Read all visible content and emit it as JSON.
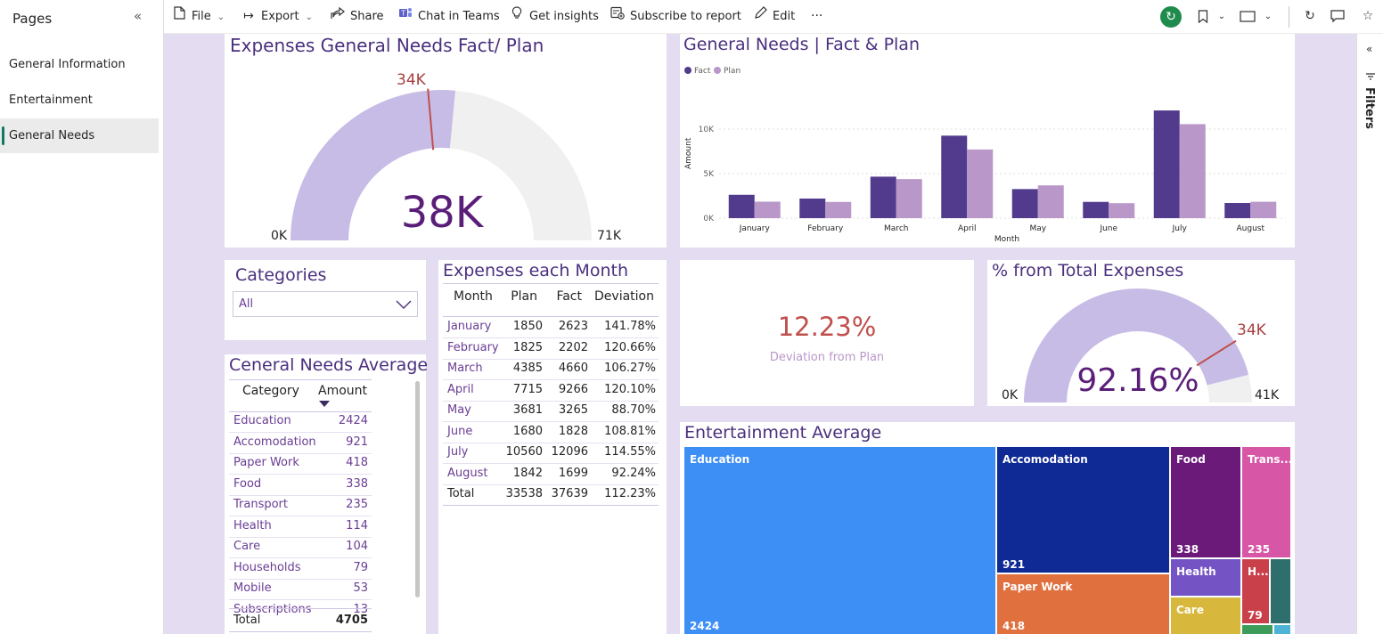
{
  "pages": {
    "title": "Pages",
    "collapse_icon": "«",
    "items": [
      {
        "label": "General Information"
      },
      {
        "label": "Entertainment"
      },
      {
        "label": "General Needs"
      }
    ]
  },
  "toolbar": {
    "file": "File",
    "export": "Export",
    "share": "Share",
    "teams": "Chat in Teams",
    "insights": "Get insights",
    "subscribe": "Subscribe to report",
    "edit": "Edit",
    "more": "···"
  },
  "filters": {
    "label": "Filters",
    "collapse_icon": "«"
  },
  "colors": {
    "canvas": "#e4dcf1",
    "fact": "#523b8d",
    "plan": "#b997c9",
    "gauge_fill": "#c7bce6",
    "gauge_empty": "#f0f0f0",
    "target": "#c0504d",
    "title": "#4a2f7e"
  },
  "gauge_main": {
    "title": "Expenses General Needs Fact/ Plan",
    "value_text": "38K",
    "min_text": "0K",
    "max_text": "71K",
    "target_text": "34K",
    "value": 37639,
    "min": 0,
    "max": 71000,
    "target": 33538
  },
  "bar_chart": {
    "title": "General Needs | Fact & Plan",
    "legend": [
      "Fact",
      "Plan"
    ],
    "ylabel": "Amount",
    "xlabel": "Month",
    "yticks": [
      "0K",
      "5K",
      "10K"
    ]
  },
  "chart_data": {
    "type": "bar",
    "title": "General Needs | Fact & Plan",
    "categories": [
      "January",
      "February",
      "March",
      "April",
      "May",
      "June",
      "July",
      "August"
    ],
    "series": [
      {
        "name": "Fact",
        "values": [
          2623,
          2202,
          4660,
          9266,
          3265,
          1828,
          12096,
          1699
        ]
      },
      {
        "name": "Plan",
        "values": [
          1850,
          1825,
          4385,
          7715,
          3681,
          1680,
          10560,
          1842
        ]
      }
    ],
    "xlabel": "Month",
    "ylabel": "Amount",
    "ylim": [
      0,
      12500
    ],
    "grid": true,
    "legend_position": "top-left"
  },
  "categories_slicer": {
    "title": "Categories",
    "value": "All"
  },
  "avg_table": {
    "title": "Ceneral Needs Average",
    "headers": [
      "Category",
      "Amount"
    ],
    "rows": [
      {
        "category": "Education",
        "amount": "2424"
      },
      {
        "category": "Accomodation",
        "amount": "921"
      },
      {
        "category": "Paper Work",
        "amount": "418"
      },
      {
        "category": "Food",
        "amount": "338"
      },
      {
        "category": "Transport",
        "amount": "235"
      },
      {
        "category": "Health",
        "amount": "114"
      },
      {
        "category": "Care",
        "amount": "104"
      },
      {
        "category": "Households",
        "amount": "79"
      },
      {
        "category": "Mobile",
        "amount": "53"
      },
      {
        "category": "Subscriptions",
        "amount": "13"
      }
    ],
    "total_label": "Total",
    "total_value": "4705"
  },
  "month_table": {
    "title": "Expenses each Month",
    "headers": [
      "Month",
      "Plan",
      "Fact",
      "Deviation"
    ],
    "rows": [
      {
        "month": "January",
        "plan": "1850",
        "fact": "2623",
        "dev": "141.78%"
      },
      {
        "month": "February",
        "plan": "1825",
        "fact": "2202",
        "dev": "120.66%"
      },
      {
        "month": "March",
        "plan": "4385",
        "fact": "4660",
        "dev": "106.27%"
      },
      {
        "month": "April",
        "plan": "7715",
        "fact": "9266",
        "dev": "120.10%"
      },
      {
        "month": "May",
        "plan": "3681",
        "fact": "3265",
        "dev": "88.70%"
      },
      {
        "month": "June",
        "plan": "1680",
        "fact": "1828",
        "dev": "108.81%"
      },
      {
        "month": "July",
        "plan": "10560",
        "fact": "12096",
        "dev": "114.55%"
      },
      {
        "month": "August",
        "plan": "1842",
        "fact": "1699",
        "dev": "92.24%"
      }
    ],
    "total": {
      "month": "Total",
      "plan": "33538",
      "fact": "37639",
      "dev": "112.23%"
    }
  },
  "kpi": {
    "value": "12.23%",
    "label": "Deviation from Plan"
  },
  "gauge_pct": {
    "title": "% from Total Expenses",
    "value_text": "92.16%",
    "min_text": "0K",
    "max_text": "41K",
    "target_text": "34K",
    "value": 37639,
    "min": 0,
    "max": 40840,
    "target": 33538
  },
  "treemap": {
    "title": "Entertainment Average",
    "cells": [
      {
        "label": "Education",
        "value": "2424",
        "color": "#3d8ef5"
      },
      {
        "label": "Accomodation",
        "value": "921",
        "color": "#0f2a94"
      },
      {
        "label": "Paper Work",
        "value": "418",
        "color": "#e0703e"
      },
      {
        "label": "Food",
        "value": "338",
        "color": "#6b1a7a"
      },
      {
        "label": "Trans...",
        "value": "235",
        "color": "#d756a6"
      },
      {
        "label": "Health",
        "value": "",
        "color": "#7454c4"
      },
      {
        "label": "H...",
        "value": "79",
        "color": "#c9404b"
      },
      {
        "label": "Care",
        "value": "",
        "color": "#d8b83c"
      }
    ]
  }
}
